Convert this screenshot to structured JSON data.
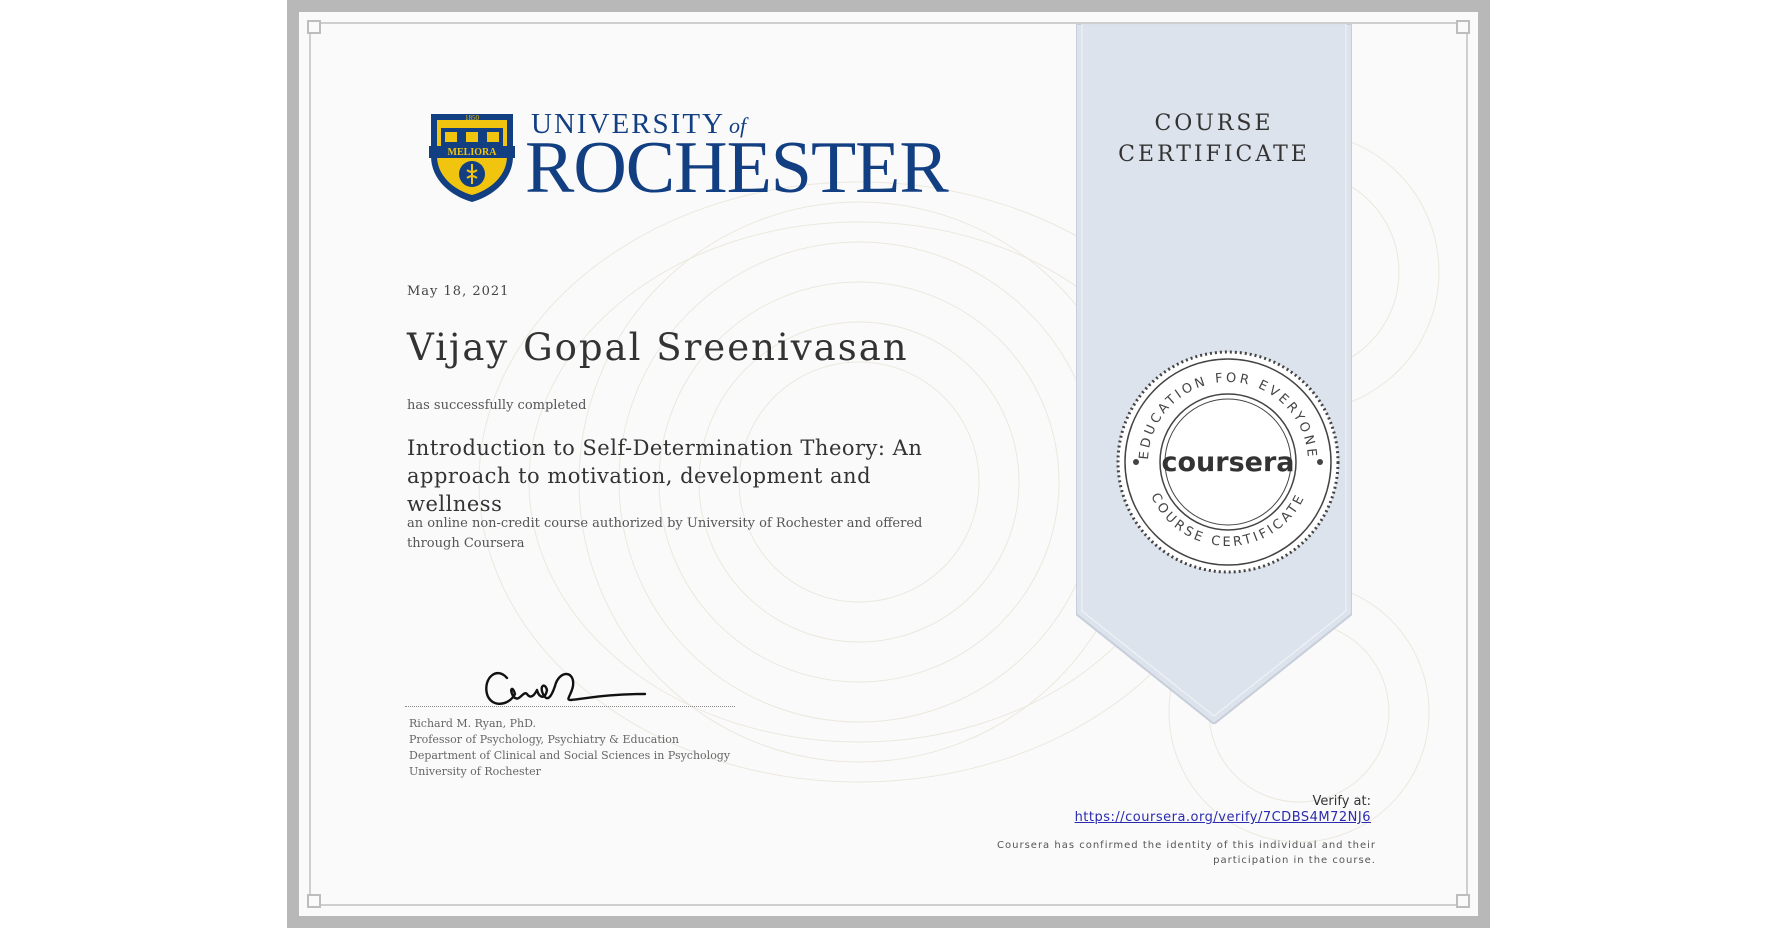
{
  "certificate": {
    "date": "May 18, 2021",
    "recipient_name": "Vijay Gopal Sreenivasan",
    "completed_text": "has successfully completed",
    "course_title": "Introduction to Self-Determination Theory: An approach to motivation, development and wellness",
    "description": "an online non-credit course authorized by University of Rochester and offered through Coursera",
    "ribbon_title": "COURSE CERTIFICATE",
    "brand_color": "#123e82",
    "ribbon_color": "#dde3ec"
  },
  "logo": {
    "university_of": "UNIVERSITY",
    "of_word": "of",
    "rochester": "ROCHESTER",
    "shield_year": "1850",
    "shield_motto": "MELIORA",
    "icon": "university-shield-icon"
  },
  "signer": {
    "name": "Richard M. Ryan, PhD.",
    "title": "Professor of Psychology, Psychiatry & Education",
    "department": "Department of Clinical and Social Sciences in Psychology",
    "institution": "University of Rochester"
  },
  "seal": {
    "brand": "coursera",
    "ring_top": "EDUCATION FOR EVERYONE",
    "ring_bottom": "COURSE CERTIFICATE"
  },
  "verify": {
    "label": "Verify at:",
    "url": "https://coursera.org/verify/7CDBS4M72NJ6",
    "confirmation": "Coursera has confirmed the identity of this individual and their participation in the course."
  }
}
